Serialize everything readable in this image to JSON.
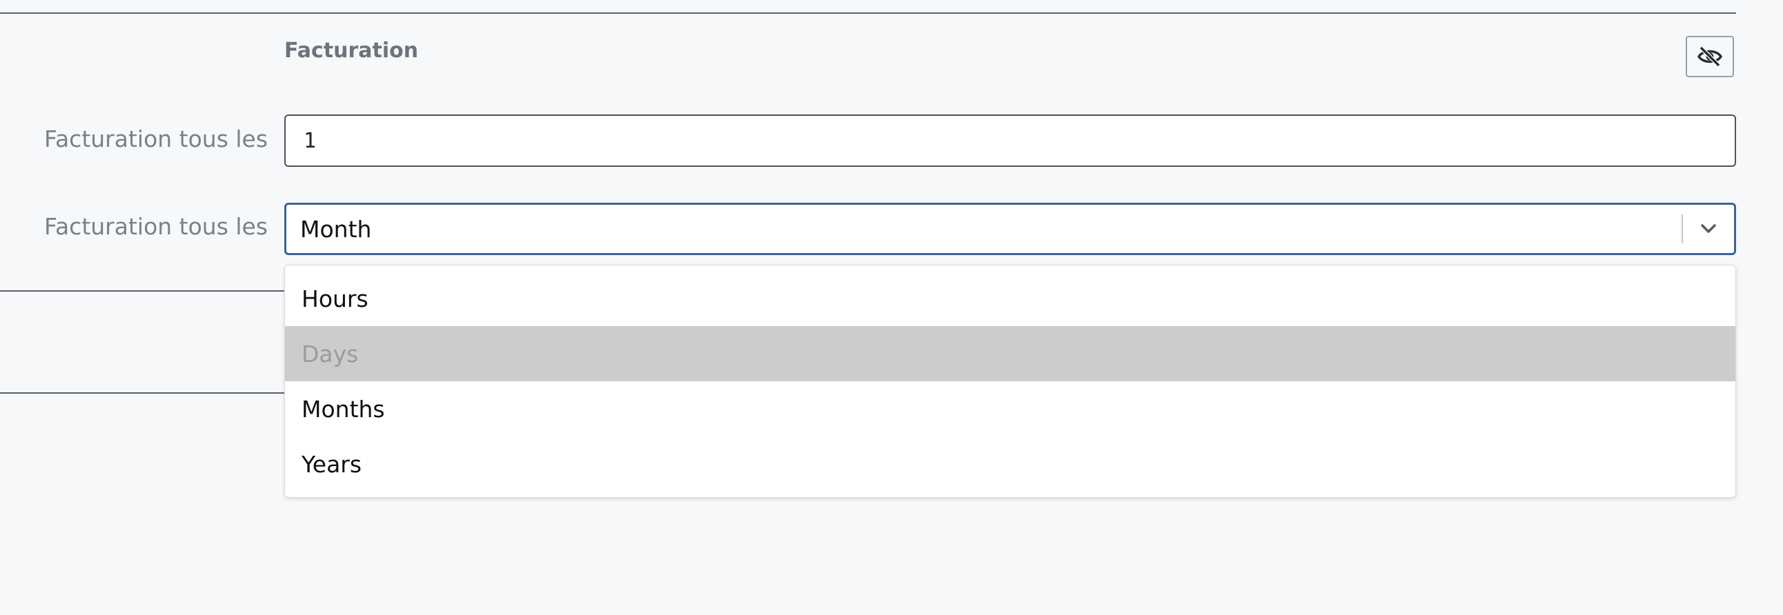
{
  "section": {
    "title": "Facturation",
    "visibility_icon": "eye-slash-icon"
  },
  "fields": [
    {
      "label": "Facturation tous les",
      "value": "1"
    },
    {
      "label": "Facturation tous les",
      "selected": "Month"
    }
  ],
  "dropdown": {
    "options": [
      "Hours",
      "Days",
      "Months",
      "Years"
    ],
    "highlighted_index": 1
  },
  "colors": {
    "background": "#f7f8fa",
    "focus_border": "#3c6397",
    "highlight_bg": "#cccccc",
    "label_text": "#7a8088"
  }
}
